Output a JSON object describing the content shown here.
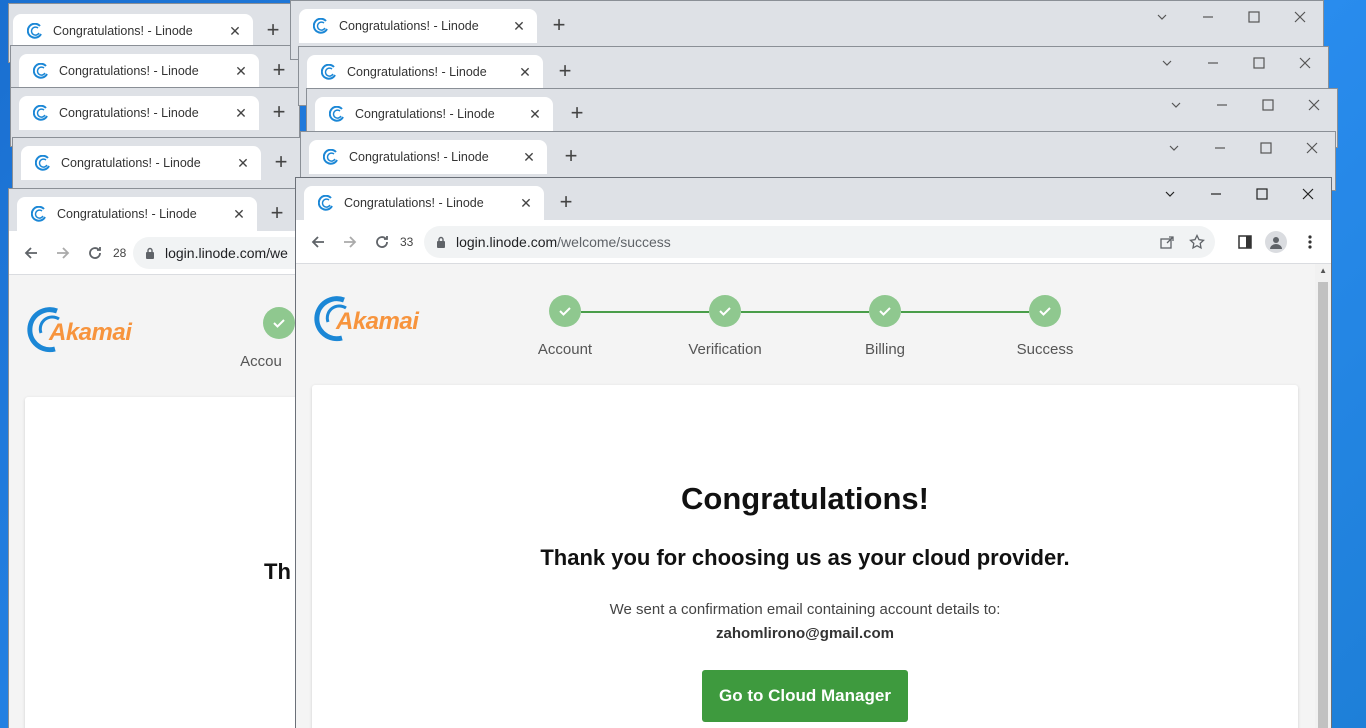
{
  "browser": {
    "tab_title": "Congratulations! - Linode",
    "new_tab_label": "+",
    "close_label": "✕",
    "url_host": "login.linode.com",
    "url_path": "/welcome/success",
    "url_host_truncated": "login.linode.com/we",
    "tab_counts": {
      "front": "33",
      "back": "28"
    }
  },
  "page": {
    "brand": "Akamai",
    "steps": [
      {
        "label": "Account"
      },
      {
        "label": "Verification"
      },
      {
        "label": "Billing"
      },
      {
        "label": "Success"
      }
    ],
    "back_step_label_partial": "Accou",
    "back_heading_partial": "Th",
    "heading": "Congratulations!",
    "subheading": "Thank you for choosing us as your cloud provider.",
    "sent_text": "We sent a confirmation email containing account details to:",
    "email": "zahomlirono@gmail.com",
    "cta_label": "Go to Cloud Manager"
  },
  "colors": {
    "accent_green": "#3e9a3e",
    "step_circle": "#8fc88f",
    "brand_orange": "#f7943d",
    "brand_blue": "#1b87d6",
    "desktop": "#1e7fd8"
  }
}
